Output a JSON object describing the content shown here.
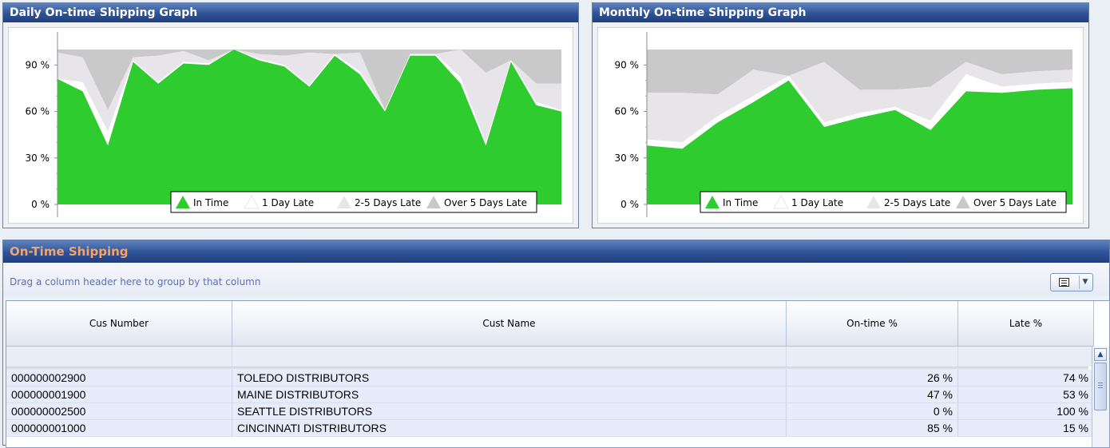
{
  "colors": {
    "in_time": "#2ecc2e",
    "one_day_late": "#ffffff",
    "two_five_days_late": "#e7e5ea",
    "over_five_days_late": "#c9c9ca",
    "title_bar": "#2f5296"
  },
  "daily_chart": {
    "title": "Daily On-time Shipping Graph",
    "chart_data": {
      "type": "area",
      "stacked": true,
      "title": "Daily On-time Shipping Graph",
      "xlabel": "",
      "ylabel": "",
      "ylim": [
        0,
        100
      ],
      "yticks": [
        "0 %",
        "30 %",
        "60 %",
        "90 %"
      ],
      "grid": false,
      "legend_position": "bottom-right",
      "x": [
        1,
        2,
        3,
        4,
        5,
        6,
        7,
        8,
        9,
        10,
        11,
        12,
        13,
        14,
        15,
        16,
        17,
        18,
        19,
        20,
        21
      ],
      "series": [
        {
          "name": "In Time",
          "values": [
            81,
            73,
            38,
            92,
            78,
            91,
            90,
            100,
            93,
            89,
            76,
            96,
            84,
            60,
            96,
            96,
            78,
            38,
            92,
            64,
            60
          ]
        },
        {
          "name": "1 Day Late",
          "values": [
            0,
            6,
            9,
            1,
            1,
            1,
            1,
            0,
            1,
            1,
            1,
            1,
            2,
            1,
            1,
            1,
            4,
            2,
            1,
            2,
            1
          ]
        },
        {
          "name": "2-5 Days Late",
          "values": [
            17,
            16,
            14,
            2,
            17,
            7,
            2,
            0,
            3,
            6,
            21,
            0,
            12,
            0,
            0,
            0,
            18,
            45,
            0,
            12,
            17
          ]
        },
        {
          "name": "Over 5 Days Late",
          "values": [
            2,
            5,
            39,
            5,
            4,
            1,
            7,
            0,
            3,
            4,
            2,
            3,
            2,
            39,
            3,
            3,
            0,
            15,
            7,
            22,
            22
          ]
        }
      ]
    }
  },
  "monthly_chart": {
    "title": "Monthly On-time Shipping Graph",
    "chart_data": {
      "type": "area",
      "stacked": true,
      "title": "Monthly On-time Shipping Graph",
      "xlabel": "",
      "ylabel": "",
      "ylim": [
        0,
        100
      ],
      "yticks": [
        "0 %",
        "30 %",
        "60 %",
        "90 %"
      ],
      "grid": false,
      "legend_position": "bottom-right",
      "x": [
        1,
        2,
        3,
        4,
        5,
        6,
        7,
        8,
        9,
        10,
        11,
        12,
        13
      ],
      "series": [
        {
          "name": "In Time",
          "values": [
            38,
            36,
            53,
            66,
            80,
            50,
            56,
            61,
            48,
            73,
            72,
            74,
            75
          ]
        },
        {
          "name": "1 Day Late",
          "values": [
            4,
            4,
            4,
            4,
            3,
            3,
            3,
            2,
            6,
            11,
            4,
            4,
            4
          ]
        },
        {
          "name": "2-5 Days Late",
          "values": [
            30,
            32,
            14,
            17,
            0,
            39,
            15,
            11,
            22,
            8,
            8,
            8,
            8
          ]
        },
        {
          "name": "Over 5 Days Late",
          "values": [
            28,
            28,
            29,
            13,
            17,
            8,
            26,
            26,
            24,
            8,
            16,
            14,
            13
          ]
        }
      ]
    }
  },
  "grid_panel": {
    "title": "On-Time Shipping",
    "group_hint": "Drag a column header here to group by that column",
    "group_button_icon": "grid-layout-icon",
    "columns": [
      "Cus Number",
      "Cust Name",
      "On-time %",
      "Late %"
    ],
    "rows": [
      [
        "000000002900",
        "TOLEDO DISTRIBUTORS",
        "26 %",
        "74 %"
      ],
      [
        "000000001900",
        "MAINE DISTRIBUTORS",
        "47 %",
        "53 %"
      ],
      [
        "000000002500",
        "SEATTLE DISTRIBUTORS",
        "0 %",
        "100 %"
      ],
      [
        "000000001000",
        "CINCINNATI DISTRIBUTORS",
        "85 %",
        "15 %"
      ]
    ]
  }
}
